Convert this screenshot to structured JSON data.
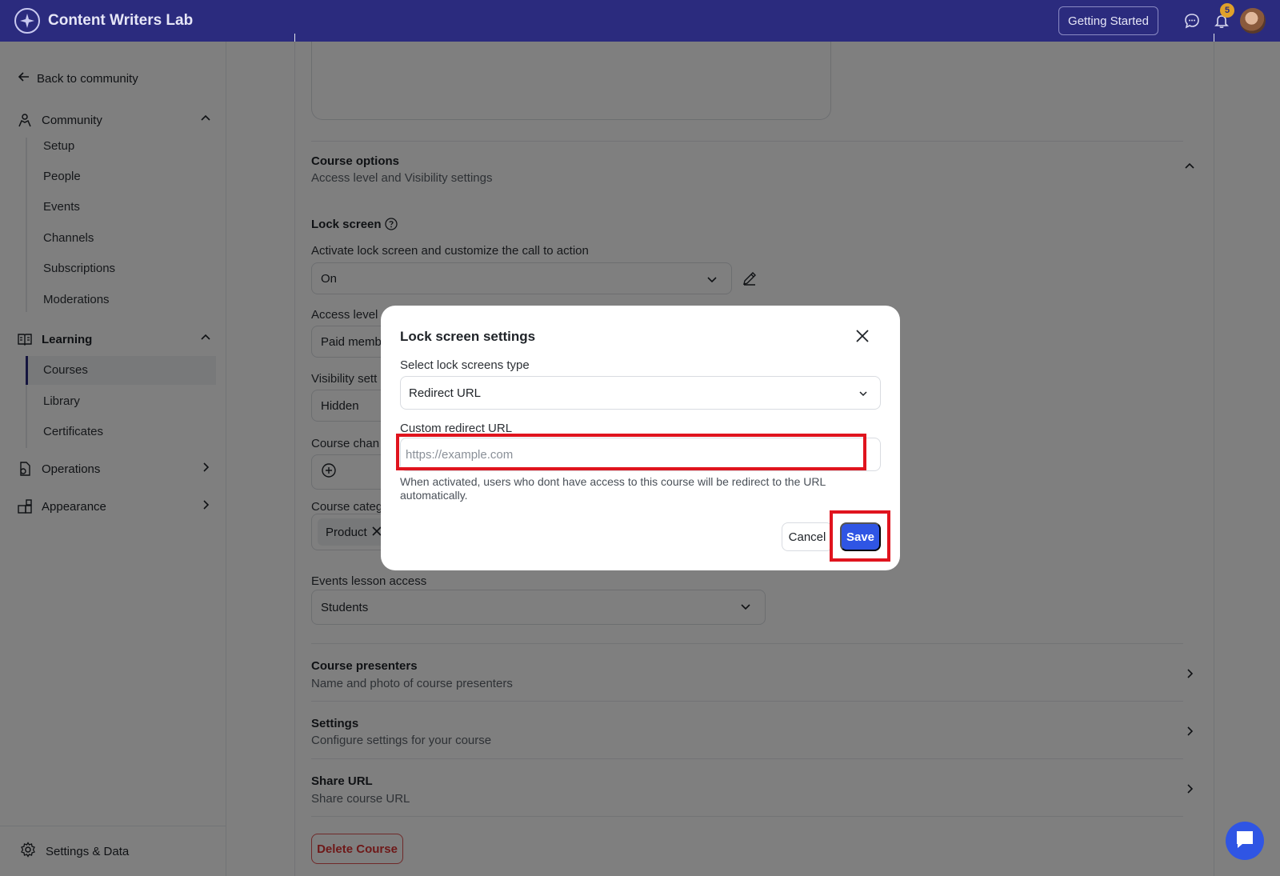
{
  "app": {
    "title": "Content Writers Lab",
    "getting_started": "Getting Started",
    "notification_count": "5"
  },
  "sidebar": {
    "back": "Back to community",
    "community": {
      "label": "Community",
      "items": [
        "Setup",
        "People",
        "Events",
        "Channels",
        "Subscriptions",
        "Moderations"
      ]
    },
    "learning": {
      "label": "Learning",
      "items": [
        "Courses",
        "Library",
        "Certificates"
      ],
      "active": "Courses"
    },
    "operations": "Operations",
    "appearance": "Appearance",
    "settings": "Settings & Data"
  },
  "main": {
    "course_options": {
      "title": "Course options",
      "subtitle": "Access level and Visibility settings"
    },
    "lock_screen": {
      "title": "Lock screen",
      "desc": "Activate lock screen and customize the call to action",
      "value": "On"
    },
    "access_level": {
      "label": "Access level",
      "value": "Paid membe"
    },
    "visibility": {
      "label": "Visibility sett",
      "value": "Hidden"
    },
    "course_channel": {
      "label": "Course chan"
    },
    "course_category": {
      "label": "Course categ",
      "tag": "Product"
    },
    "events_lesson": {
      "label": "Events lesson access",
      "value": "Students"
    },
    "presenters": {
      "title": "Course presenters",
      "subtitle": "Name and photo of course presenters"
    },
    "settings": {
      "title": "Settings",
      "subtitle": "Configure settings for your course"
    },
    "share": {
      "title": "Share URL",
      "subtitle": "Share course URL"
    },
    "delete": "Delete Course"
  },
  "modal": {
    "title": "Lock screen settings",
    "type_label": "Select lock screens type",
    "type_value": "Redirect URL",
    "url_label": "Custom redirect URL",
    "url_placeholder": "https://example.com",
    "url_value": "",
    "help": "When activated, users who dont have access to this course will be redirect to the URL automatically.",
    "cancel": "Cancel",
    "save": "Save"
  },
  "colors": {
    "topbar": "#2b2b7e",
    "primary": "#2f55e4",
    "highlight": "#e0141e",
    "badge": "#e0a12a"
  }
}
